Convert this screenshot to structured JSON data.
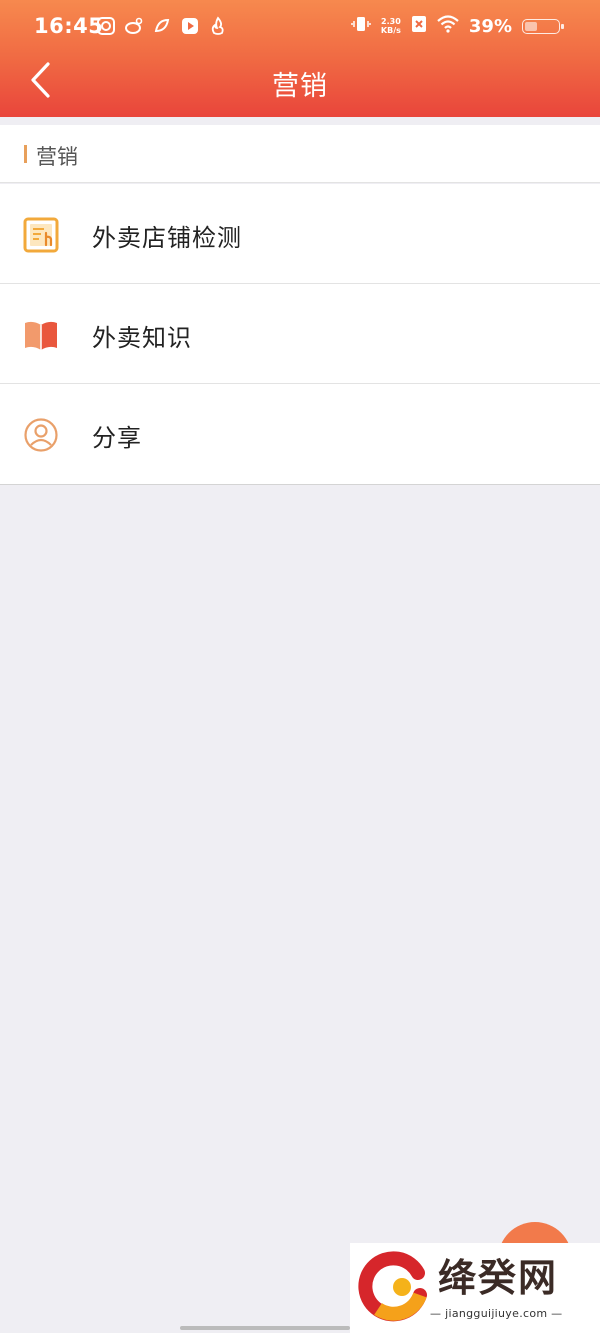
{
  "status_bar": {
    "time": "16:45",
    "net_speed_value": "2.30",
    "net_speed_unit": "KB/s",
    "battery_percent": "39%",
    "battery_level": 0.39,
    "left_icons": [
      "qq-icon",
      "weibo-icon",
      "app-icon",
      "video-icon",
      "hot-icon"
    ],
    "right_icons": [
      "vibrate-icon",
      "no-sim-icon",
      "wifi-icon",
      "battery-icon"
    ]
  },
  "nav": {
    "title": "营销",
    "back_icon": "chevron-left-icon"
  },
  "section": {
    "title": "营销",
    "accent_color": "#e8a05b"
  },
  "menu": {
    "items": [
      {
        "label": "外卖店铺检测",
        "icon": "store-check-icon"
      },
      {
        "label": "外卖知识",
        "icon": "book-icon"
      },
      {
        "label": "分享",
        "icon": "user-circle-icon"
      }
    ]
  },
  "watermark": {
    "title": "绛癸网",
    "url": "jiangguijiuye.com"
  },
  "colors": {
    "header_top": "#f7894e",
    "header_bottom": "#e9453b",
    "background": "#efeef3"
  }
}
